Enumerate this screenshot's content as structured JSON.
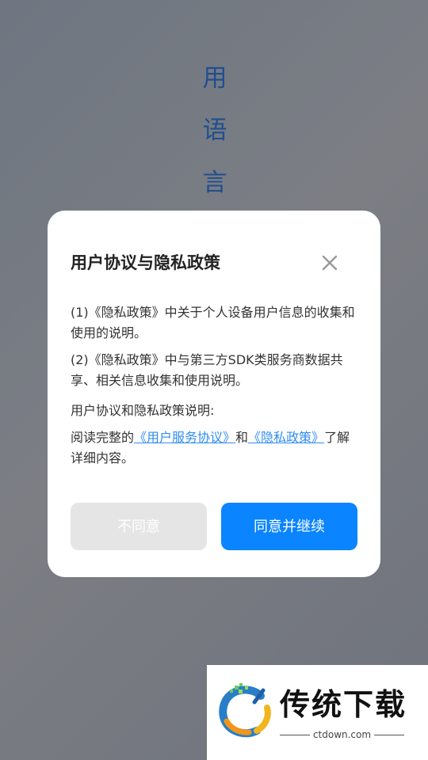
{
  "background": {
    "vertical_text": [
      "用",
      "语",
      "言"
    ]
  },
  "dialog": {
    "title": "用户协议与隐私政策",
    "close_icon": "close-icon",
    "paragraphs": {
      "p1": "(1)《隐私政策》中关于个人设备用户信息的收集和使用的说明。",
      "p2": "(2)《隐私政策》中与第三方SDK类服务商数据共享、相关信息收集和使用说明。",
      "p3": "用户协议和隐私政策说明:"
    },
    "read_sentence": {
      "prefix": "阅读完整的",
      "user_agreement_link": "《用户服务协议》",
      "middle": "和",
      "privacy_policy_link": "《隐私政策》",
      "suffix": "了解详细内容。"
    },
    "buttons": {
      "disagree": "不同意",
      "agree": "同意并继续"
    },
    "colors": {
      "accent": "#0a84ff",
      "link": "#2f8df0"
    }
  },
  "watermark": {
    "brand": "传统下载",
    "domain": "ctdown.com"
  }
}
